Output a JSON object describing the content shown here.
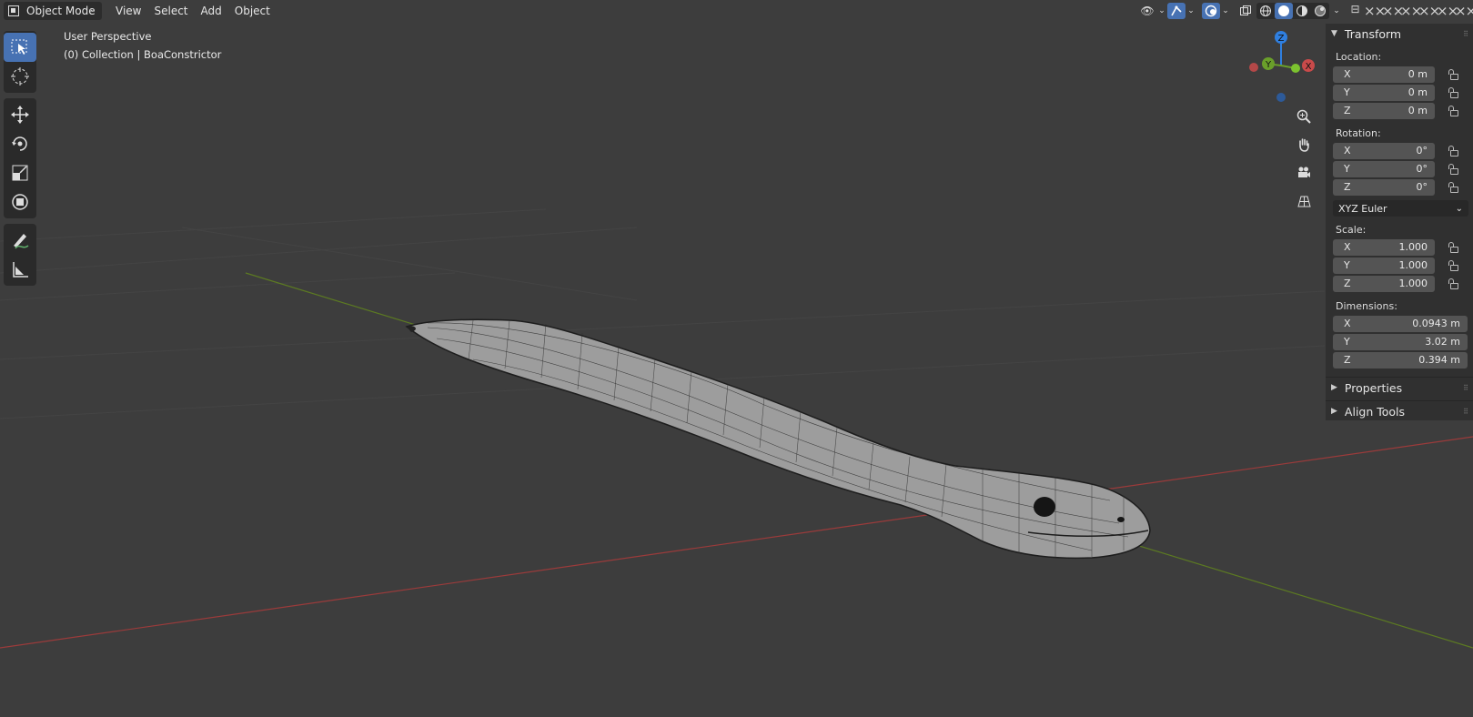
{
  "header": {
    "mode_label": "Object Mode",
    "menu": [
      "View",
      "Select",
      "Add",
      "Object"
    ]
  },
  "overlay": {
    "view_name": "User Perspective",
    "collection_info": "(0) Collection | BoaConstrictor"
  },
  "gizmo": {
    "z": "Z",
    "y": "Y",
    "x": "X"
  },
  "panel": {
    "transform_title": "Transform",
    "location_label": "Location:",
    "location": [
      {
        "axis": "X",
        "value": "0 m"
      },
      {
        "axis": "Y",
        "value": "0 m"
      },
      {
        "axis": "Z",
        "value": "0 m"
      }
    ],
    "rotation_label": "Rotation:",
    "rotation": [
      {
        "axis": "X",
        "value": "0°"
      },
      {
        "axis": "Y",
        "value": "0°"
      },
      {
        "axis": "Z",
        "value": "0°"
      }
    ],
    "rotation_mode": "XYZ Euler",
    "scale_label": "Scale:",
    "scale": [
      {
        "axis": "X",
        "value": "1.000"
      },
      {
        "axis": "Y",
        "value": "1.000"
      },
      {
        "axis": "Z",
        "value": "1.000"
      }
    ],
    "dimensions_label": "Dimensions:",
    "dimensions": [
      {
        "axis": "X",
        "value": "0.0943 m"
      },
      {
        "axis": "Y",
        "value": "3.02 m"
      },
      {
        "axis": "Z",
        "value": "0.394 m"
      }
    ],
    "properties_title": "Properties",
    "align_tools_title": "Align Tools"
  },
  "colors": {
    "viewport_bg": "#3d3d3d",
    "active_blue": "#4772b3",
    "axis_x": "#c94a4a",
    "axis_y": "#6b8f2a",
    "axis_z": "#2f7fe0"
  },
  "icons": [
    "select-box-icon",
    "cursor-icon",
    "move-icon",
    "rotate-icon",
    "scale-icon",
    "transform-icon",
    "annotate-icon",
    "measure-icon",
    "zoom-icon",
    "hand-icon",
    "camera-icon",
    "grid-icon"
  ]
}
